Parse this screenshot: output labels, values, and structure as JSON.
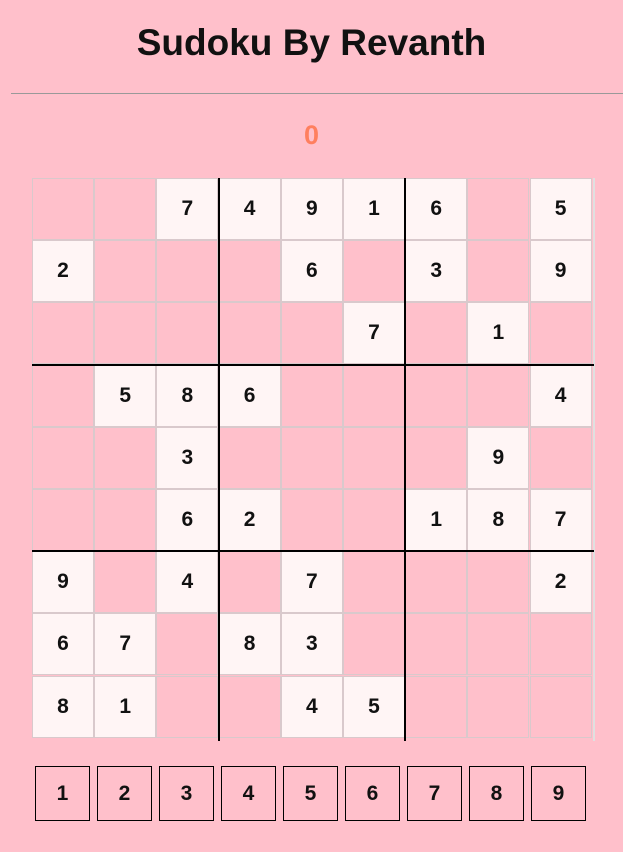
{
  "header": {
    "title": "Sudoku By Revanth"
  },
  "score": "0",
  "colors": {
    "background": "#ffc0cb",
    "given_cell": "#fff5f5",
    "score": "#ff7f5f"
  },
  "board": [
    [
      "",
      "",
      "7",
      "4",
      "9",
      "1",
      "6",
      "",
      "5"
    ],
    [
      "2",
      "",
      "",
      "",
      "6",
      "",
      "3",
      "",
      "9"
    ],
    [
      "",
      "",
      "",
      "",
      "",
      "7",
      "",
      "1",
      ""
    ],
    [
      "",
      "5",
      "8",
      "6",
      "",
      "",
      "",
      "",
      "4"
    ],
    [
      "",
      "",
      "3",
      "",
      "",
      "",
      "",
      "9",
      ""
    ],
    [
      "",
      "",
      "6",
      "2",
      "",
      "",
      "1",
      "8",
      "7"
    ],
    [
      "9",
      "",
      "4",
      "",
      "7",
      "",
      "",
      "",
      "2"
    ],
    [
      "6",
      "7",
      "",
      "8",
      "3",
      "",
      "",
      "",
      ""
    ],
    [
      "8",
      "1",
      "",
      "",
      "4",
      "5",
      "",
      "",
      ""
    ]
  ],
  "digit_selector": [
    "1",
    "2",
    "3",
    "4",
    "5",
    "6",
    "7",
    "8",
    "9"
  ]
}
